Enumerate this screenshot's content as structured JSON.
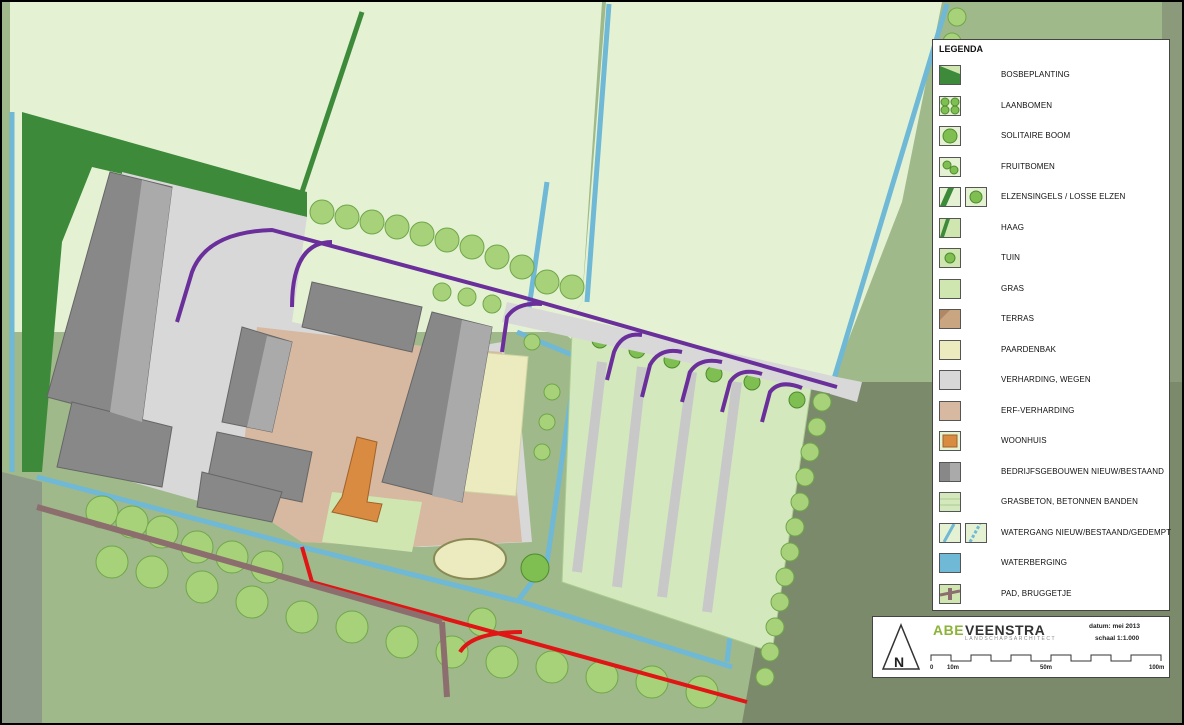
{
  "legend": {
    "title": "LEGENDA",
    "items": [
      {
        "label": "BOSBEPLANTING",
        "swatch": "bos"
      },
      {
        "label": "LAANBOMEN",
        "swatch": "laan"
      },
      {
        "label": "SOLITAIRE BOOM",
        "swatch": "sol"
      },
      {
        "label": "FRUITBOMEN",
        "swatch": "fruit"
      },
      {
        "label": "ELZENSINGELS / LOSSE ELZEN",
        "swatch": "elzen"
      },
      {
        "label": "HAAG",
        "swatch": "haag"
      },
      {
        "label": "TUIN",
        "swatch": "tuin"
      },
      {
        "label": "GRAS",
        "swatch": "gras"
      },
      {
        "label": "TERRAS",
        "swatch": "terras"
      },
      {
        "label": "PAARDENBAK",
        "swatch": "paard"
      },
      {
        "label": "VERHARDING, WEGEN",
        "swatch": "verh"
      },
      {
        "label": "ERF-VERHARDING",
        "swatch": "erf"
      },
      {
        "label": "WOONHUIS",
        "swatch": "woon"
      },
      {
        "label": "BEDRIJFSGEBOUWEN NIEUW/BESTAAND",
        "swatch": "bedrijf"
      },
      {
        "label": "GRASBETON,  BETONNEN BANDEN",
        "swatch": "grasbeton"
      },
      {
        "label": "WATERGANG NIEUW/BESTAAND/GEDEMPT",
        "swatch": "water"
      },
      {
        "label": "WATERBERGING",
        "swatch": "berging"
      },
      {
        "label": "PAD, BRUGGETJE",
        "swatch": "pad"
      }
    ]
  },
  "titleblock": {
    "brand_abe": "ABE",
    "brand_veenstra": "VEENSTRA",
    "brand_sub": "LANDSCHAPSARCHITECT",
    "north": "N",
    "datum": "datum: mei 2013",
    "schaal": "schaal 1:1.000",
    "ticks": [
      "0",
      "10m",
      "50m",
      "100m"
    ]
  },
  "colors": {
    "field": "#e4f2d3",
    "grass": "#cfe6b0",
    "forest": "#3d8a3a",
    "tree": "#a8d27a",
    "road": "#d8d8d8",
    "yard": "#d6b9a0",
    "building": "#888888",
    "house": "#d98b42",
    "water": "#6fb8d6",
    "route_purple": "#6a2f9b",
    "route_red": "#e01515",
    "path": "#8d6e6e"
  }
}
